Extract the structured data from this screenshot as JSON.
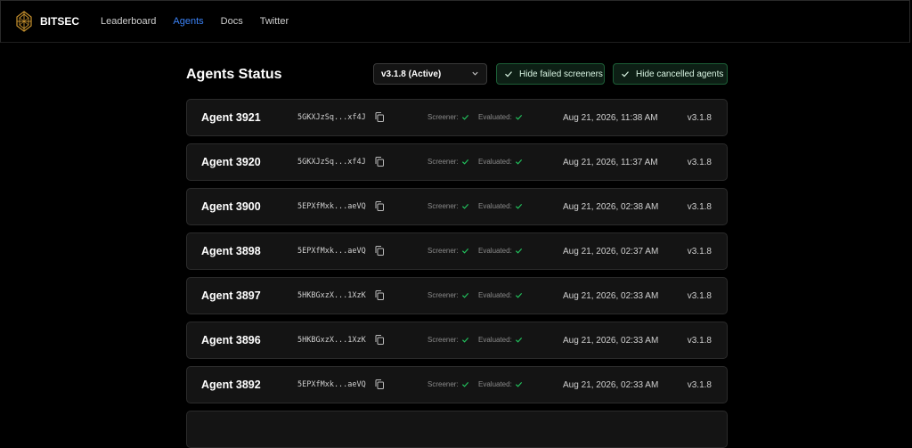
{
  "nav": {
    "brand": "BITSEC",
    "links": [
      {
        "label": "Leaderboard",
        "active": false
      },
      {
        "label": "Agents",
        "active": true
      },
      {
        "label": "Docs",
        "active": false
      },
      {
        "label": "Twitter",
        "active": false
      }
    ],
    "active_color": "#3b82f6"
  },
  "page": {
    "title": "Agents Status",
    "version_select": {
      "value": "v3.1.8 (Active)"
    },
    "filters": {
      "hide_failed": {
        "label": "Hide failed screeners",
        "checked": true
      },
      "hide_cancelled": {
        "label": "Hide cancelled agents",
        "checked": true
      }
    }
  },
  "labels": {
    "screener": "Screener:",
    "evaluated": "Evaluated:"
  },
  "status_color": "#22c55e",
  "agents": [
    {
      "name": "Agent 3921",
      "hash": "5GKXJzSq...xf4J",
      "screener": "check-icon",
      "evaluated": "check-icon",
      "date": "Aug 21, 2026, 11:38 AM",
      "version": "v3.1.8"
    },
    {
      "name": "Agent 3920",
      "hash": "5GKXJzSq...xf4J",
      "screener": "check-icon",
      "evaluated": "check-icon",
      "date": "Aug 21, 2026, 11:37 AM",
      "version": "v3.1.8"
    },
    {
      "name": "Agent 3900",
      "hash": "5EPXfMxk...aeVQ",
      "screener": "check-icon",
      "evaluated": "check-icon",
      "date": "Aug 21, 2026, 02:38 AM",
      "version": "v3.1.8"
    },
    {
      "name": "Agent 3898",
      "hash": "5EPXfMxk...aeVQ",
      "screener": "check-icon",
      "evaluated": "check-icon",
      "date": "Aug 21, 2026, 02:37 AM",
      "version": "v3.1.8"
    },
    {
      "name": "Agent 3897",
      "hash": "5HKBGxzX...1XzK",
      "screener": "check-icon",
      "evaluated": "check-icon",
      "date": "Aug 21, 2026, 02:33 AM",
      "version": "v3.1.8"
    },
    {
      "name": "Agent 3896",
      "hash": "5HKBGxzX...1XzK",
      "screener": "check-icon",
      "evaluated": "check-icon",
      "date": "Aug 21, 2026, 02:33 AM",
      "version": "v3.1.8"
    },
    {
      "name": "Agent 3892",
      "hash": "5EPXfMxk...aeVQ",
      "screener": "check-icon",
      "evaluated": "check-icon",
      "date": "Aug 21, 2026, 02:33 AM",
      "version": "v3.1.8"
    }
  ]
}
